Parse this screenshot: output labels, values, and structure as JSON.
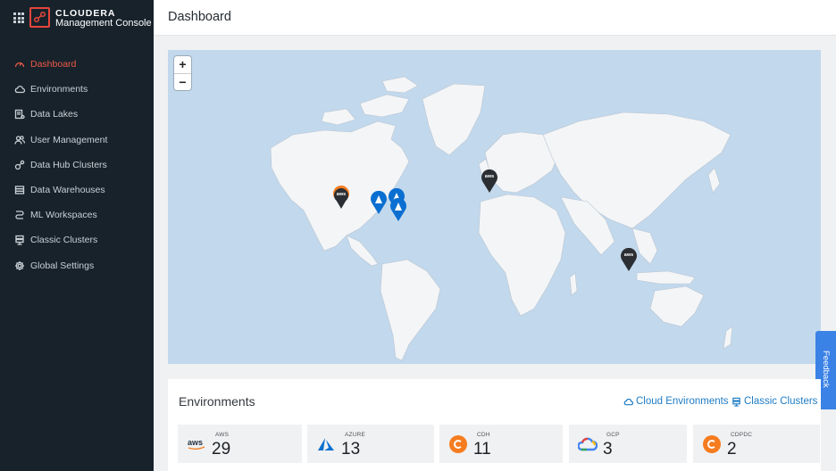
{
  "brand": {
    "name": "CLOUDERA",
    "product": "Management Console"
  },
  "sidebar": {
    "items": [
      {
        "label": "Dashboard",
        "icon": "dashboard-icon",
        "active": true
      },
      {
        "label": "Environments",
        "icon": "cloud-icon",
        "active": false
      },
      {
        "label": "Data Lakes",
        "icon": "data-lake-icon",
        "active": false
      },
      {
        "label": "User Management",
        "icon": "users-icon",
        "active": false
      },
      {
        "label": "Data Hub Clusters",
        "icon": "data-hub-icon",
        "active": false
      },
      {
        "label": "Data Warehouses",
        "icon": "warehouse-icon",
        "active": false
      },
      {
        "label": "ML Workspaces",
        "icon": "ml-icon",
        "active": false
      },
      {
        "label": "Classic Clusters",
        "icon": "classic-cluster-icon",
        "active": false
      },
      {
        "label": "Global Settings",
        "icon": "gear-icon",
        "active": false
      }
    ]
  },
  "header": {
    "title": "Dashboard"
  },
  "map": {
    "zoom_in": "+",
    "zoom_out": "−",
    "markers": [
      {
        "provider": "aws",
        "label": "aws"
      },
      {
        "provider": "azure",
        "label": ""
      },
      {
        "provider": "azure",
        "label": ""
      },
      {
        "provider": "azure",
        "label": ""
      },
      {
        "provider": "aws",
        "label": "aws"
      },
      {
        "provider": "aws",
        "label": "aws"
      }
    ],
    "colors": {
      "water": "#c2d8ec",
      "land": "#f4f5f7",
      "aws_marker": "#2b2f33",
      "azure_marker": "#0a6fd1"
    }
  },
  "feedback": {
    "label": "Feedback"
  },
  "environments": {
    "title": "Environments",
    "links": {
      "cloud": "Cloud Environments",
      "classic": "Classic Clusters"
    },
    "cards": [
      {
        "label": "AWS",
        "value": "29",
        "icon": "aws-icon"
      },
      {
        "label": "AZURE",
        "value": "13",
        "icon": "azure-icon"
      },
      {
        "label": "CDH",
        "value": "11",
        "icon": "cdh-icon"
      },
      {
        "label": "GCP",
        "value": "3",
        "icon": "gcp-icon"
      },
      {
        "label": "CDPDC",
        "value": "2",
        "icon": "cdpdc-icon"
      }
    ]
  }
}
